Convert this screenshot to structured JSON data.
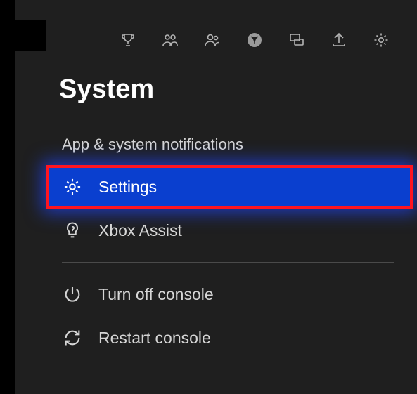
{
  "page": {
    "title": "System"
  },
  "menu": {
    "notifications": {
      "label": "App & system notifications"
    },
    "settings": {
      "label": "Settings"
    },
    "assist": {
      "label": "Xbox Assist"
    },
    "turnoff": {
      "label": "Turn off console"
    },
    "restart": {
      "label": "Restart console"
    }
  }
}
